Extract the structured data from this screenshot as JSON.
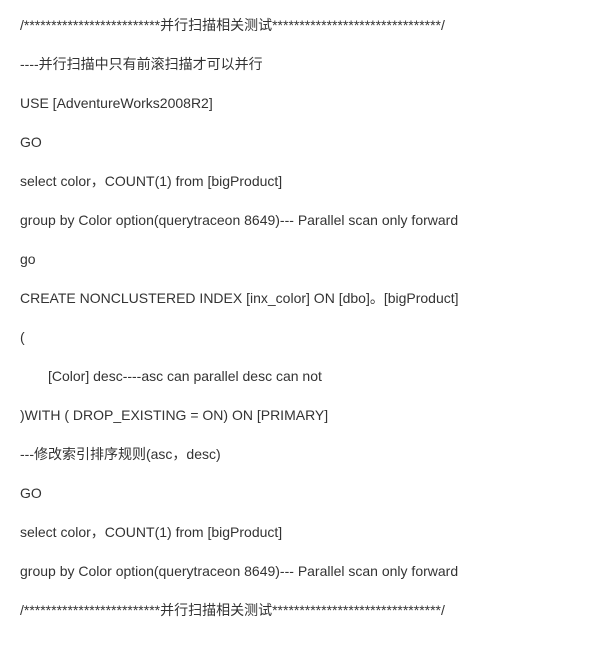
{
  "lines": [
    {
      "text": "/*************************并行扫描相关测试*******************************/",
      "indent": false
    },
    {
      "text": "----并行扫描中只有前滚扫描才可以并行",
      "indent": false
    },
    {
      "text": "USE [AdventureWorks2008R2]",
      "indent": false
    },
    {
      "text": "GO",
      "indent": false
    },
    {
      "text": "select color，COUNT(1) from [bigProduct]",
      "indent": false
    },
    {
      "text": "group by Color option(querytraceon 8649)--- Parallel scan only forward",
      "indent": false
    },
    {
      "text": "go",
      "indent": false
    },
    {
      "text": "CREATE NONCLUSTERED INDEX [inx_color] ON [dbo]。[bigProduct]",
      "indent": false
    },
    {
      "text": "(",
      "indent": false
    },
    {
      "text": "[Color] desc----asc can parallel desc can not",
      "indent": true
    },
    {
      "text": ")WITH ( DROP_EXISTING = ON) ON [PRIMARY]",
      "indent": false
    },
    {
      "text": "---修改索引排序规则(asc，desc)",
      "indent": false
    },
    {
      "text": "GO",
      "indent": false
    },
    {
      "text": "select color，COUNT(1) from [bigProduct]",
      "indent": false
    },
    {
      "text": "group by Color option(querytraceon 8649)--- Parallel scan only forward",
      "indent": false
    },
    {
      "text": "/*************************并行扫描相关测试*******************************/",
      "indent": false
    }
  ]
}
